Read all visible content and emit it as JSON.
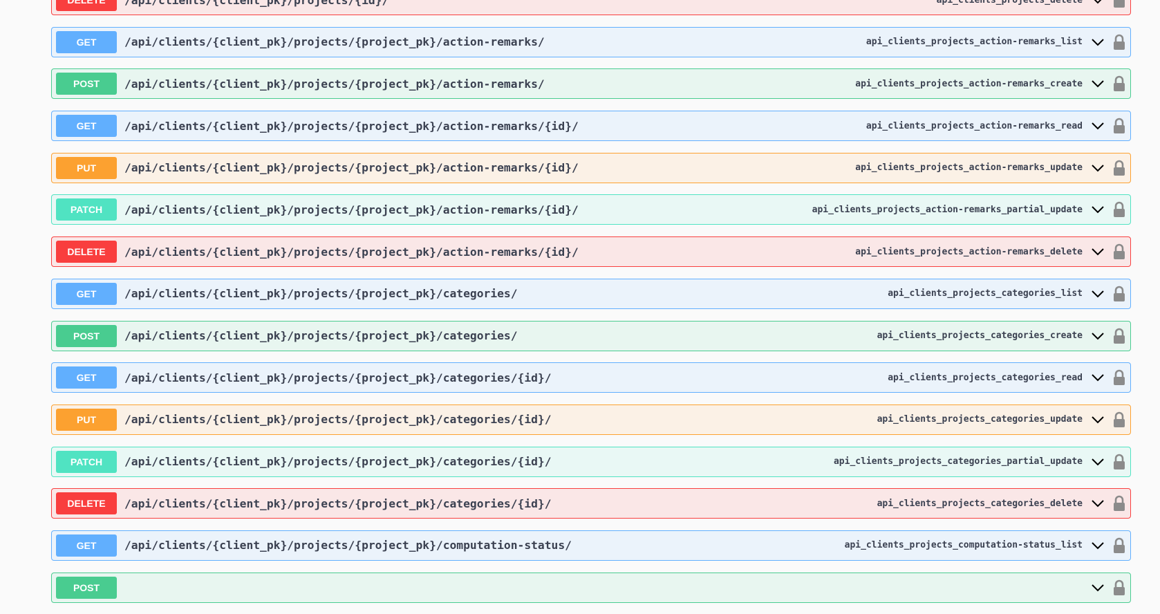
{
  "operations": [
    {
      "method": "DELETE",
      "cls": "delete",
      "path": "/api/clients/{client_pk}/projects/{id}/",
      "operation_id": "api_clients_projects_delete"
    },
    {
      "method": "GET",
      "cls": "get",
      "path": "/api/clients/{client_pk}/projects/{project_pk}/action-remarks/",
      "operation_id": "api_clients_projects_action-remarks_list"
    },
    {
      "method": "POST",
      "cls": "post",
      "path": "/api/clients/{client_pk}/projects/{project_pk}/action-remarks/",
      "operation_id": "api_clients_projects_action-remarks_create"
    },
    {
      "method": "GET",
      "cls": "get",
      "path": "/api/clients/{client_pk}/projects/{project_pk}/action-remarks/{id}/",
      "operation_id": "api_clients_projects_action-remarks_read"
    },
    {
      "method": "PUT",
      "cls": "put",
      "path": "/api/clients/{client_pk}/projects/{project_pk}/action-remarks/{id}/",
      "operation_id": "api_clients_projects_action-remarks_update"
    },
    {
      "method": "PATCH",
      "cls": "patch",
      "path": "/api/clients/{client_pk}/projects/{project_pk}/action-remarks/{id}/",
      "operation_id": "api_clients_projects_action-remarks_partial_update"
    },
    {
      "method": "DELETE",
      "cls": "delete",
      "path": "/api/clients/{client_pk}/projects/{project_pk}/action-remarks/{id}/",
      "operation_id": "api_clients_projects_action-remarks_delete"
    },
    {
      "method": "GET",
      "cls": "get",
      "path": "/api/clients/{client_pk}/projects/{project_pk}/categories/",
      "operation_id": "api_clients_projects_categories_list"
    },
    {
      "method": "POST",
      "cls": "post",
      "path": "/api/clients/{client_pk}/projects/{project_pk}/categories/",
      "operation_id": "api_clients_projects_categories_create"
    },
    {
      "method": "GET",
      "cls": "get",
      "path": "/api/clients/{client_pk}/projects/{project_pk}/categories/{id}/",
      "operation_id": "api_clients_projects_categories_read"
    },
    {
      "method": "PUT",
      "cls": "put",
      "path": "/api/clients/{client_pk}/projects/{project_pk}/categories/{id}/",
      "operation_id": "api_clients_projects_categories_update"
    },
    {
      "method": "PATCH",
      "cls": "patch",
      "path": "/api/clients/{client_pk}/projects/{project_pk}/categories/{id}/",
      "operation_id": "api_clients_projects_categories_partial_update"
    },
    {
      "method": "DELETE",
      "cls": "delete",
      "path": "/api/clients/{client_pk}/projects/{project_pk}/categories/{id}/",
      "operation_id": "api_clients_projects_categories_delete"
    },
    {
      "method": "GET",
      "cls": "get",
      "path": "/api/clients/{client_pk}/projects/{project_pk}/computation-status/",
      "operation_id": "api_clients_projects_computation-status_list"
    },
    {
      "method": "POST",
      "cls": "post",
      "path": "",
      "operation_id": ""
    }
  ],
  "icons": {
    "expand": "chevron-down-icon",
    "auth": "lock-icon"
  },
  "colors": {
    "get": "#61affe",
    "post": "#49cc90",
    "put": "#fca130",
    "patch": "#50e3c2",
    "delete": "#f93e3e"
  }
}
